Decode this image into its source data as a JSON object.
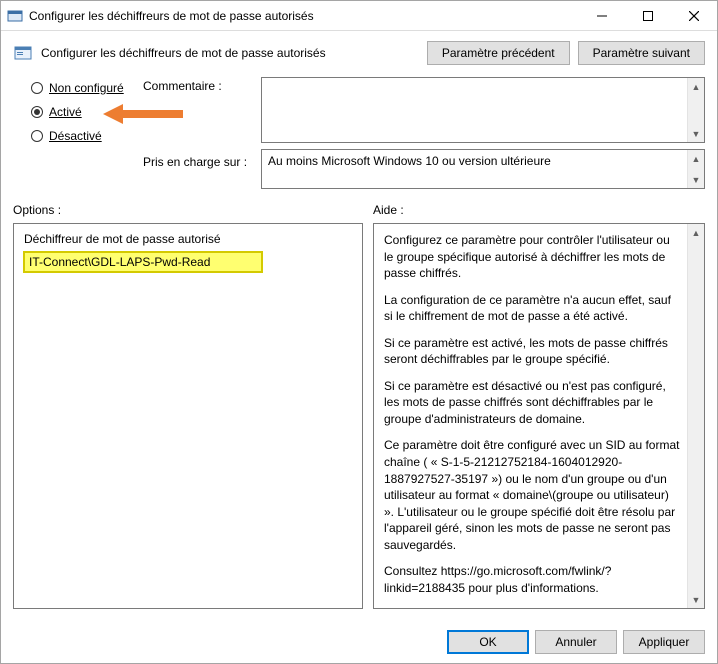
{
  "window": {
    "title": "Configurer les déchiffreurs de mot de passe autorisés"
  },
  "header": {
    "title": "Configurer les déchiffreurs de mot de passe autorisés",
    "prev_btn": "Paramètre précédent",
    "next_btn": "Paramètre suivant"
  },
  "state": {
    "not_configured": "Non configuré",
    "enabled": "Activé",
    "disabled": "Désactivé",
    "selected": "enabled"
  },
  "labels": {
    "comment": "Commentaire :",
    "supported": "Pris en charge sur :",
    "options": "Options :",
    "help": "Aide :"
  },
  "supported_text": "Au moins Microsoft Windows 10 ou version ultérieure",
  "options": {
    "field_label": "Déchiffreur de mot de passe autorisé",
    "field_value": "IT-Connect\\GDL-LAPS-Pwd-Read"
  },
  "help": {
    "p1": "Configurez ce paramètre pour contrôler l'utilisateur ou le groupe spécifique autorisé à déchiffrer les mots de passe chiffrés.",
    "p2": "La configuration de ce paramètre n'a aucun effet, sauf si le chiffrement de mot de passe a été activé.",
    "p3": "Si ce paramètre est activé, les mots de passe chiffrés seront déchiffrables par le groupe spécifié.",
    "p4": "Si ce paramètre est désactivé ou n'est pas configuré, les mots de passe chiffrés sont déchiffrables par le groupe d'administrateurs de domaine.",
    "p5": "Ce paramètre doit être configuré avec un SID au format chaîne ( « S-1-5-21212752184-1604012920-1887927527-35197 ») ou le nom d'un groupe ou d'un utilisateur au format « domaine\\(groupe ou utilisateur) ». L'utilisateur ou le groupe spécifié doit être résolu par l'appareil géré, sinon les mots de passe ne seront pas sauvegardés.",
    "p6": "Consultez https://go.microsoft.com/fwlink/?linkid=2188435 pour plus d'informations."
  },
  "footer": {
    "ok": "OK",
    "cancel": "Annuler",
    "apply": "Appliquer"
  }
}
